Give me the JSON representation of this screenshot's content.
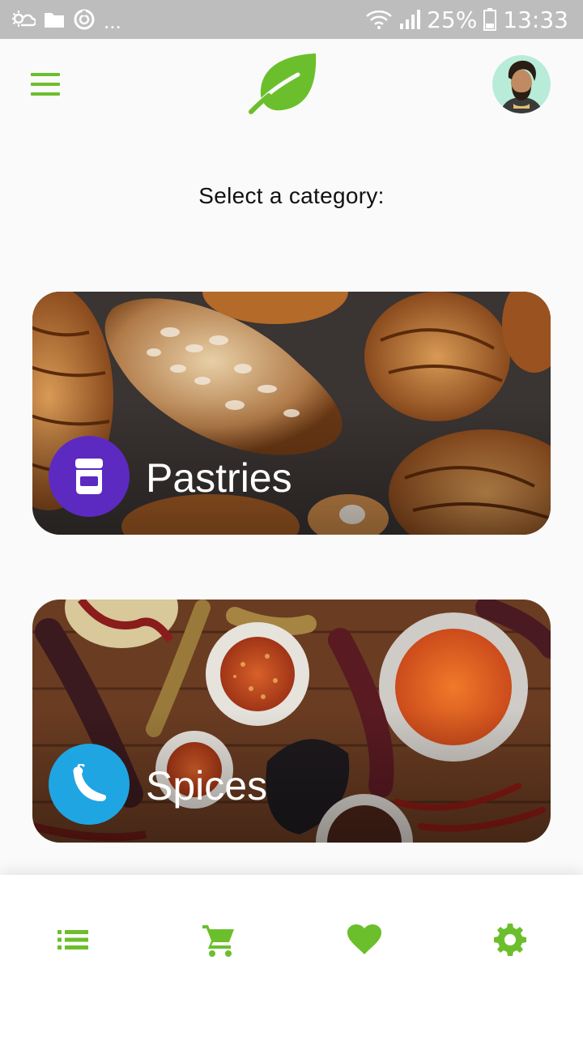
{
  "status_bar": {
    "left_icons": [
      "weather-icon",
      "folder-icon",
      "sync-icon"
    ],
    "more": "...",
    "battery": "25%",
    "time": "13:33"
  },
  "header": {
    "menu_icon": "hamburger-menu-icon",
    "logo_icon": "leaf-logo-icon",
    "avatar_icon": "user-avatar"
  },
  "page": {
    "title": "Select a category:"
  },
  "categories": [
    {
      "label": "Pastries",
      "icon": "jar-icon",
      "color": "#5c2ac1"
    },
    {
      "label": "Spices",
      "icon": "chili-pepper-icon",
      "color": "#1fa5e2"
    }
  ],
  "bottom_nav": {
    "items": [
      {
        "icon": "list-icon"
      },
      {
        "icon": "cart-icon"
      },
      {
        "icon": "heart-icon"
      },
      {
        "icon": "settings-gear-icon"
      }
    ]
  },
  "colors": {
    "accent": "#6cbf2c",
    "status_bar": "#bdbdbd"
  }
}
